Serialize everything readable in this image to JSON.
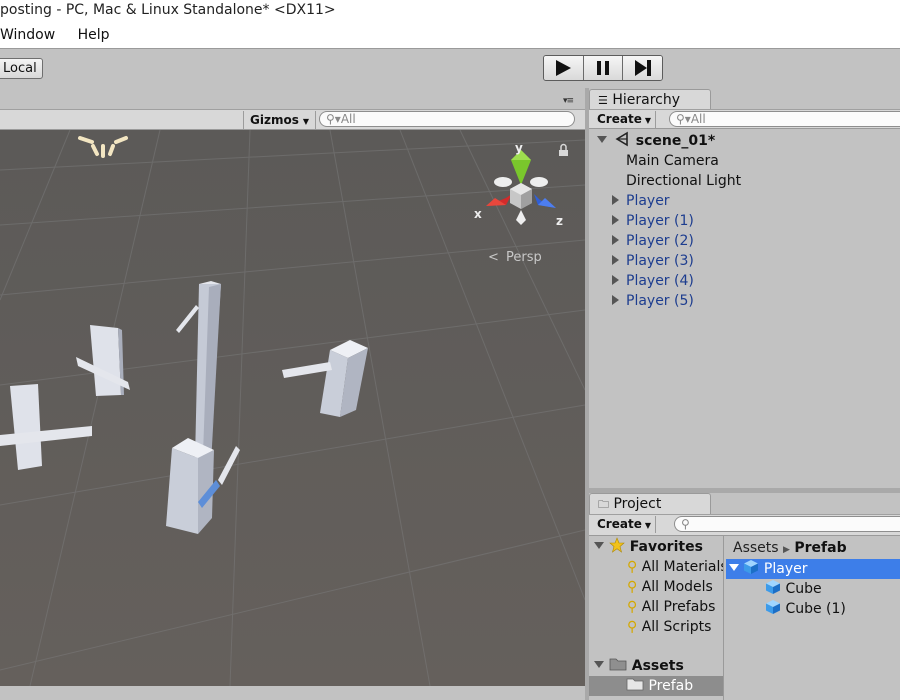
{
  "window": {
    "title": "posting - PC, Mac & Linux Standalone* <DX11>"
  },
  "menu": {
    "items": [
      "Window",
      "Help"
    ]
  },
  "toolbar": {
    "local_label": "Local"
  },
  "scene": {
    "gizmos_label": "Gizmos",
    "search_placeholder": "All",
    "axis_y": "y",
    "axis_x": "x",
    "axis_z": "z",
    "persp_label": "Persp"
  },
  "hierarchy": {
    "tab_label": "Hierarchy",
    "create_label": "Create",
    "search_placeholder": "All",
    "scene_name": "scene_01*",
    "items": [
      {
        "label": "Main Camera",
        "prefab": false,
        "expandable": false
      },
      {
        "label": "Directional Light",
        "prefab": false,
        "expandable": false
      },
      {
        "label": "Player",
        "prefab": true,
        "expandable": true
      },
      {
        "label": "Player (1)",
        "prefab": true,
        "expandable": true
      },
      {
        "label": "Player (2)",
        "prefab": true,
        "expandable": true
      },
      {
        "label": "Player (3)",
        "prefab": true,
        "expandable": true
      },
      {
        "label": "Player (4)",
        "prefab": true,
        "expandable": true
      },
      {
        "label": "Player (5)",
        "prefab": true,
        "expandable": true
      }
    ]
  },
  "project": {
    "tab_label": "Project",
    "create_label": "Create",
    "favorites_label": "Favorites",
    "favorites": [
      "All Materials",
      "All Models",
      "All Prefabs",
      "All Scripts"
    ],
    "assets_label": "Assets",
    "folders": [
      "Prefab"
    ],
    "breadcrumb": {
      "root": "Assets",
      "current": "Prefab"
    },
    "files": [
      {
        "label": "Player",
        "indent": 0,
        "selected": true,
        "expanded": true
      },
      {
        "label": "Cube",
        "indent": 1,
        "selected": false,
        "expanded": false
      },
      {
        "label": "Cube (1)",
        "indent": 1,
        "selected": false,
        "expanded": false
      }
    ]
  },
  "colors": {
    "scene_bg": "#5b5b5b",
    "selection": "#3d7ee9",
    "prefab_text": "#1d3d8f",
    "axis_x": "#d22b2b",
    "axis_y": "#7ac72c",
    "axis_z": "#2f5fd8"
  }
}
